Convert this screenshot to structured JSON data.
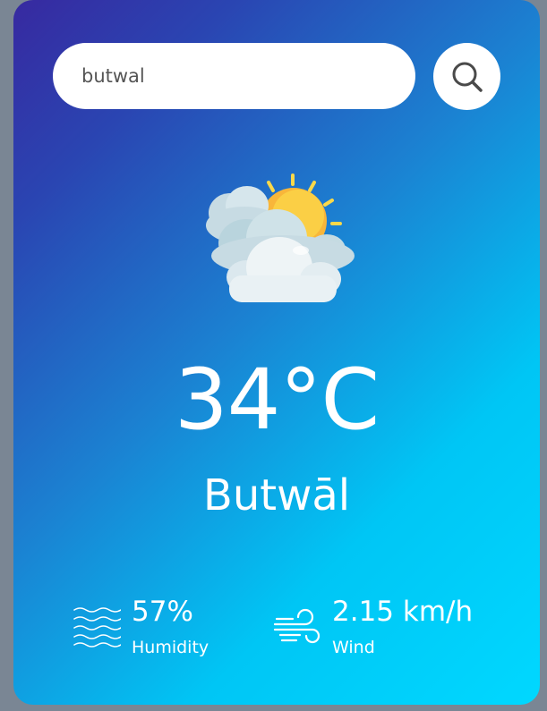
{
  "search": {
    "value": "butwal",
    "placeholder": "",
    "button_icon": "search-icon"
  },
  "weather": {
    "icon": "partly-cloudy-icon",
    "temperature": "34°C",
    "city": "Butwāl"
  },
  "details": {
    "humidity": {
      "icon": "humidity-waves-icon",
      "value": "57%",
      "label": "Humidity"
    },
    "wind": {
      "icon": "wind-icon",
      "value": "2.15 km/h",
      "label": "Wind"
    }
  },
  "colors": {
    "gradient_start": "#3729a0",
    "gradient_end": "#00d8ff",
    "text": "#ffffff",
    "page_background": "#7a8694"
  }
}
